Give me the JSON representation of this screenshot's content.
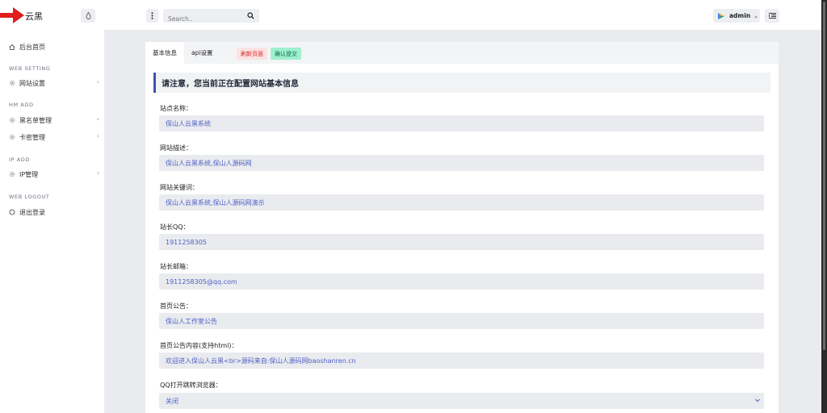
{
  "brand": {
    "name": "云黑"
  },
  "sidebar": {
    "home_label": "后台首页",
    "sections": [
      {
        "heading": "WEB SETTING",
        "items": [
          {
            "label": "网站设置"
          }
        ]
      },
      {
        "heading": "HM ADD",
        "items": [
          {
            "label": "黑名单管理"
          },
          {
            "label": "卡密管理"
          }
        ]
      },
      {
        "heading": "IP ADD",
        "items": [
          {
            "label": "IP管理"
          }
        ]
      },
      {
        "heading": "WEB LOGOUT",
        "items": [
          {
            "label": "退出登录"
          }
        ]
      }
    ]
  },
  "header": {
    "search_placeholder": "Search..",
    "username": "admin"
  },
  "tabs": {
    "basic": "基本信息",
    "api": "api设置"
  },
  "actions": {
    "refresh": "刷新页面",
    "submit": "确认提交"
  },
  "notice": "请注意，您当前正在配置网站基本信息",
  "form": {
    "fields": [
      {
        "label": "站点名称：",
        "value": "保山人云黑系统"
      },
      {
        "label": "网站描述：",
        "value": "保山人云黑系统,保山人源码网"
      },
      {
        "label": "网站关键词：",
        "value": "保山人云黑系统,保山人源码网演示"
      },
      {
        "label": "站长QQ：",
        "value": "1911258305"
      },
      {
        "label": "站长邮箱：",
        "value": "1911258305@qq.com"
      },
      {
        "label": "首页公告：",
        "value": "保山人工作室公告"
      },
      {
        "label": "首页公告内容(支持html)：",
        "value": "欢迎进入保山人云黑<br>源码来自:保山人源码网baoshanren.cn"
      },
      {
        "label": "QQ打开跳转浏览器：",
        "value": "关闭"
      }
    ]
  },
  "colors": {
    "accent": "#3f51b5",
    "arrow": "#e11d1d",
    "refresh": "#d12b2b",
    "submit": "#9ef0cf"
  },
  "icons": [
    "arrow-right-icon",
    "droplet-icon",
    "home-icon",
    "gear-icon",
    "power-icon",
    "vertical-dots-icon",
    "search-icon",
    "avatar-icon",
    "chevron-down-icon",
    "panel-icon",
    "chevron-left-icon"
  ]
}
